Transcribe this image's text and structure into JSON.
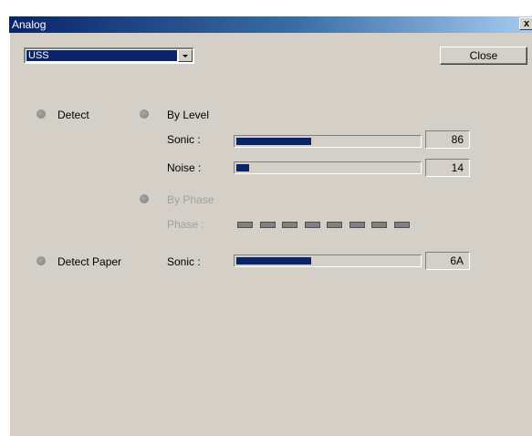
{
  "window": {
    "title": "Analog",
    "close_glyph": "x"
  },
  "sensor_select": {
    "selected": "USS"
  },
  "close_button": {
    "label": "Close"
  },
  "detect": {
    "label": "Detect",
    "indicator": "gray-led"
  },
  "by_level": {
    "label": "By Level",
    "sonic": {
      "label": "Sonic :",
      "value": "86",
      "fill_fraction": 0.41
    },
    "noise": {
      "label": "Noise :",
      "value": "14",
      "fill_fraction": 0.07
    }
  },
  "by_phase": {
    "label": "By Phase",
    "phase_label": "Phase :",
    "segments": 8
  },
  "detect_paper": {
    "label": "Detect Paper",
    "sonic": {
      "label": "Sonic :",
      "value": "6A",
      "fill_fraction": 0.41
    }
  },
  "colors": {
    "bar_fill": "#0a246a",
    "face": "#d4d0c8",
    "led": "#8a8a8a"
  }
}
